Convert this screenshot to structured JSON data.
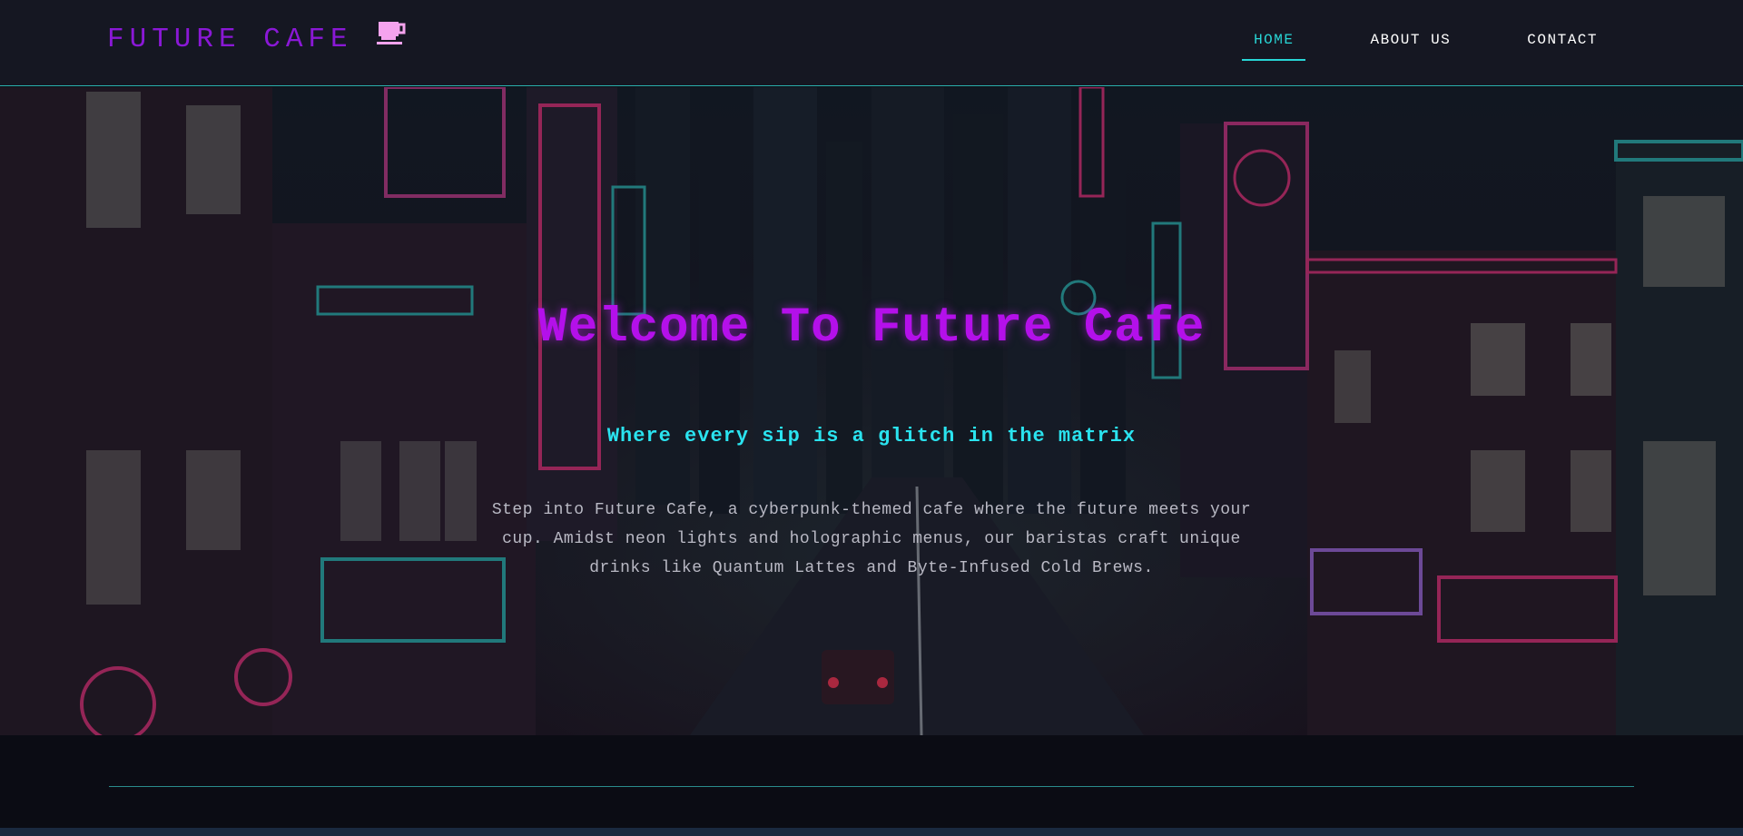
{
  "header": {
    "brand_name": "FUTURE CAFE",
    "brand_icon": "coffee-cup-icon",
    "nav": [
      {
        "label": "HOME",
        "active": true
      },
      {
        "label": "ABOUT US",
        "active": false
      },
      {
        "label": "CONTACT",
        "active": false
      }
    ]
  },
  "hero": {
    "title": "Welcome To Future Cafe",
    "subtitle": "Where every sip is a glitch in the matrix",
    "body": "Step into Future Cafe, a cyberpunk-themed cafe where the future meets your cup. Amidst neon lights and holographic menus, our baristas craft unique drinks like Quantum Lattes and Byte-Infused Cold Brews."
  },
  "colors": {
    "brand": "#8a18d6",
    "title": "#b410ea",
    "accent_cyan": "#28d6d6",
    "header_bg": "#151722",
    "footer_bg": "#0b0c14"
  }
}
